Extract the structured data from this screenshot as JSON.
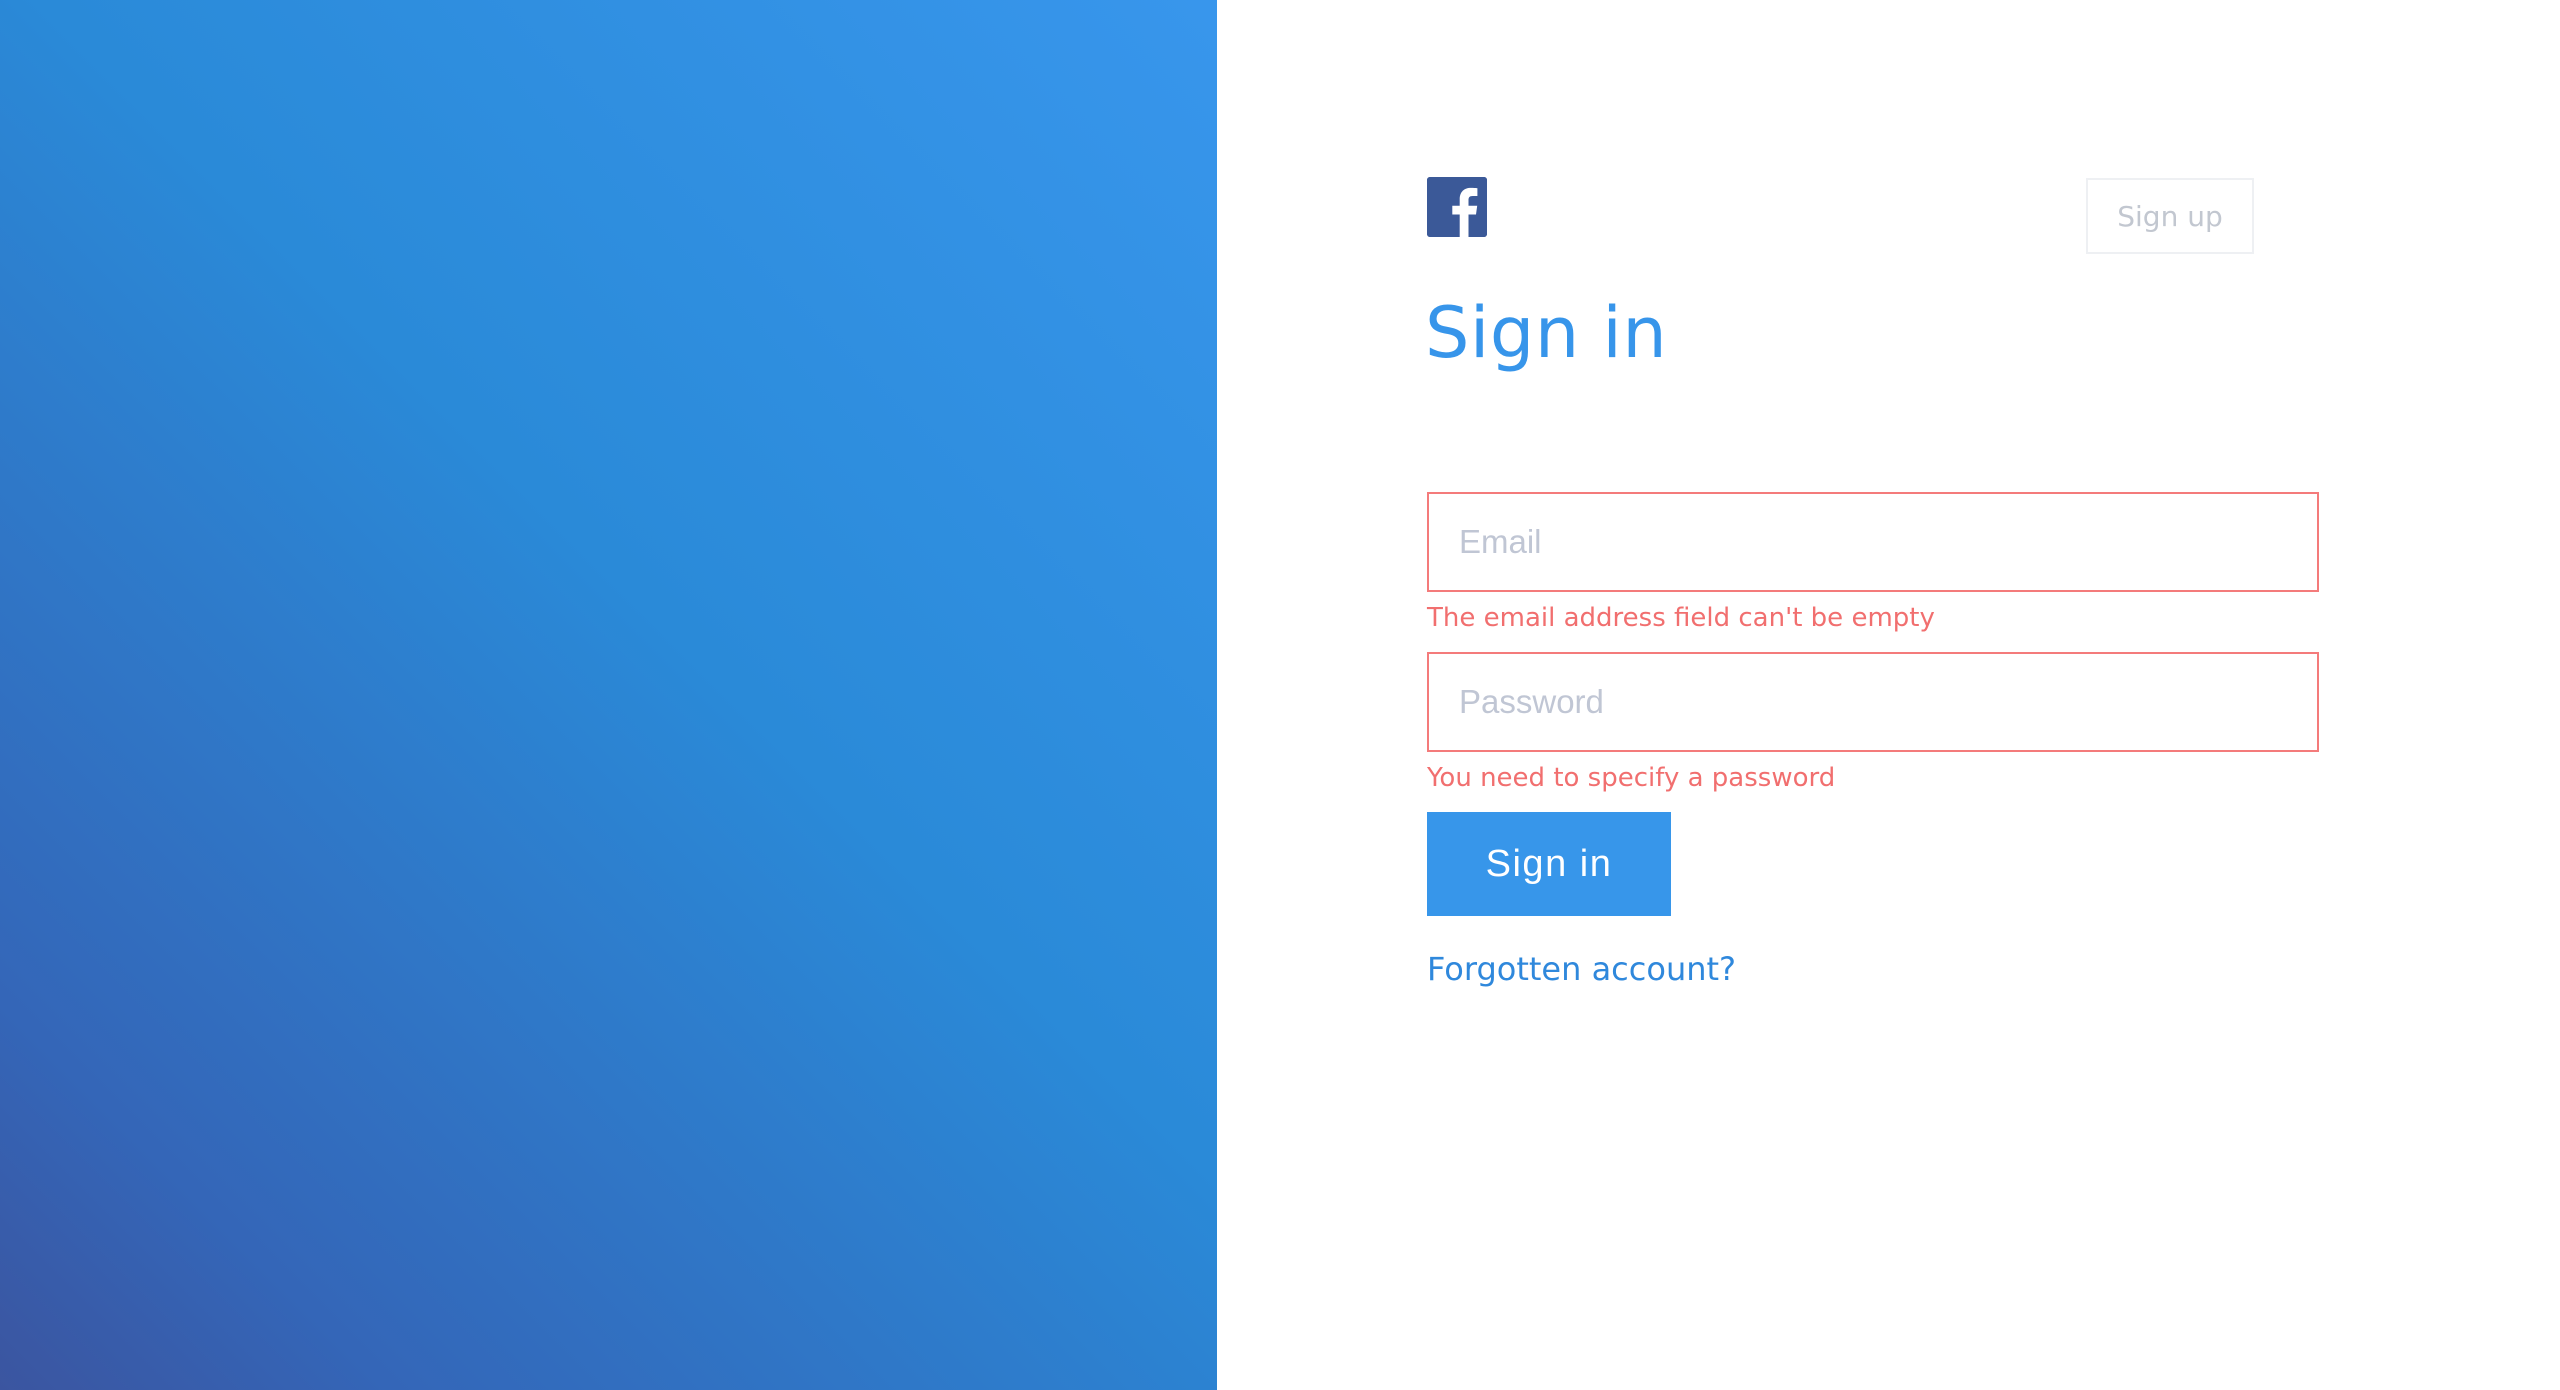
{
  "colors": {
    "accent": "#3796ea",
    "brand_facebook": "#3b5998",
    "error": "#f16f6f",
    "hero_gradient": [
      "#3896ec",
      "#2a8ad8",
      "#3466b8",
      "#3b55a0"
    ]
  },
  "header": {
    "logo_icon": "facebook-icon",
    "signup_label": "Sign up"
  },
  "form": {
    "title": "Sign in",
    "email": {
      "placeholder": "Email",
      "value": "",
      "error": "The email address field can't be empty"
    },
    "password": {
      "placeholder": "Password",
      "value": "",
      "error": "You need to specify a password"
    },
    "submit_label": "Sign in",
    "forgot_label": "Forgotten account?"
  }
}
